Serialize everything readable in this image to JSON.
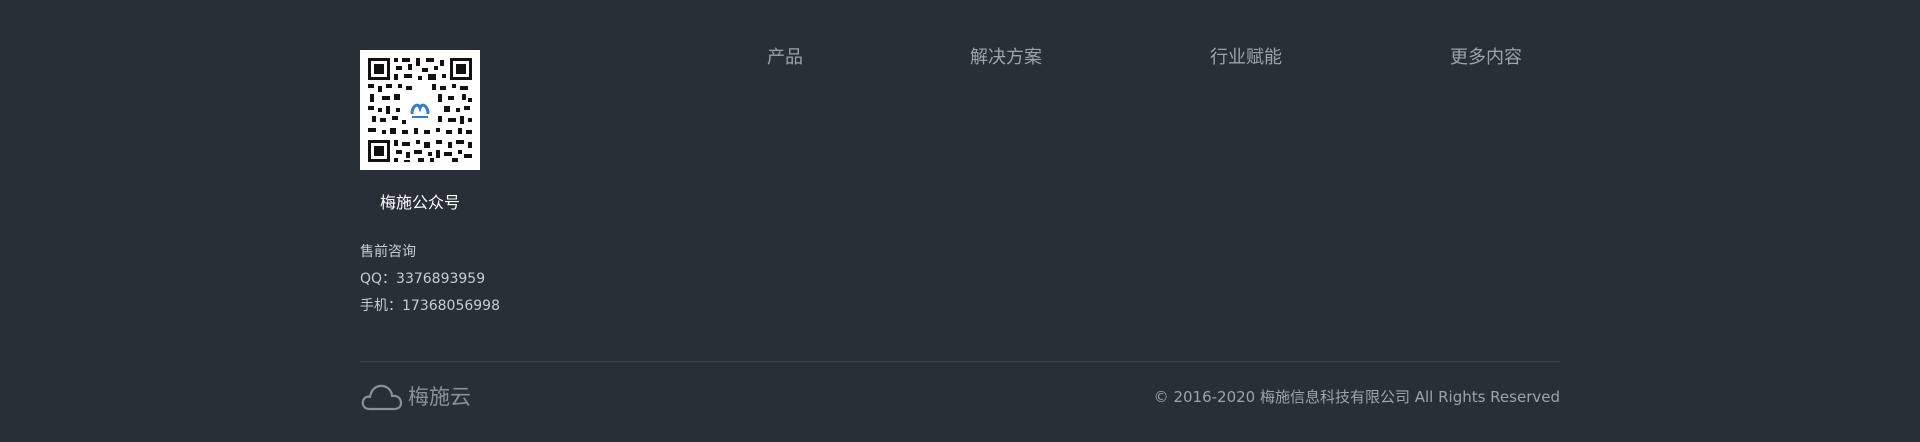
{
  "qr": {
    "label": "梅施公众号",
    "center_logo_color": "#2f7fd1"
  },
  "contact": {
    "heading": "售前咨询",
    "qq": "QQ：3376893959",
    "phone": "手机：17368056998"
  },
  "nav": {
    "products": "产品",
    "solutions": "解决方案",
    "industry": "行业赋能",
    "more": "更多内容"
  },
  "brand": {
    "name": "梅施云",
    "icon": "cloud-icon"
  },
  "copyright": "© 2016-2020 梅施信息科技有限公司 All Rights Reserved",
  "colors": {
    "background": "#292f36",
    "divider": "#3d444c",
    "nav_text": "#9ea3a9",
    "label_text": "#ffffff"
  }
}
